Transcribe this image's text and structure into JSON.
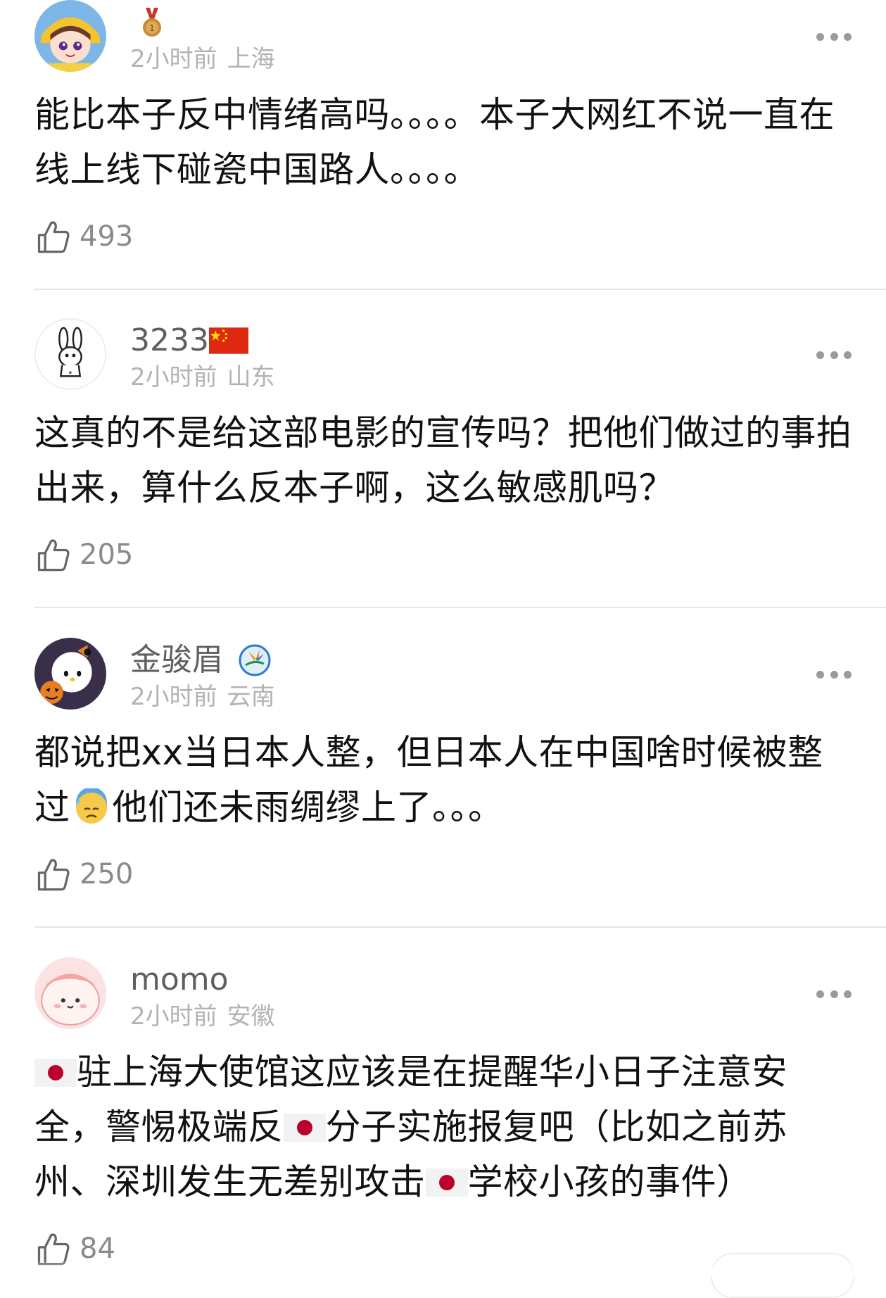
{
  "comments": [
    {
      "username": "",
      "badge_icon": "bronze-medal-icon",
      "time": "2小时前",
      "location": "上海",
      "text": "能比本子反中情绪高吗。。。。本子大网红不说一直在线上线下碰瓷中国路人。。。。",
      "likes": "493"
    },
    {
      "username": "3233",
      "badge_icon": "china-flag-icon",
      "time": "2小时前",
      "location": "山东",
      "text": "这真的不是给这部电影的宣传吗？把他们做过的事拍出来，算什么反本子啊，这么敏感肌吗？",
      "likes": "205"
    },
    {
      "username": "金骏眉",
      "badge_icon": "bird-of-paradise-icon",
      "time": "2小时前",
      "location": "云南",
      "text_a": "都说把xx当日本人整，但日本人在中国啥时候被整过",
      "text_emoji": "cold-sweat-emoji",
      "text_b": "他们还未雨绸缪上了。。。",
      "likes": "250"
    },
    {
      "username": "momo",
      "time": "2小时前",
      "location": "安徽",
      "text_1": "驻上海大使馆这应该是在提醒华小日子注意安全，警惕极端反",
      "text_2": "分子实施报复吧（比如之前苏州、深圳发生无差别攻击",
      "text_3": "学校小孩的事件）",
      "flag_icon": "japan-flag-icon",
      "likes": "84"
    }
  ],
  "colors": {
    "username": "#5f5f5f",
    "meta": "#b3b3b3",
    "text": "#111111",
    "likes": "#8a8a8a",
    "divider": "#e6e6e6"
  }
}
